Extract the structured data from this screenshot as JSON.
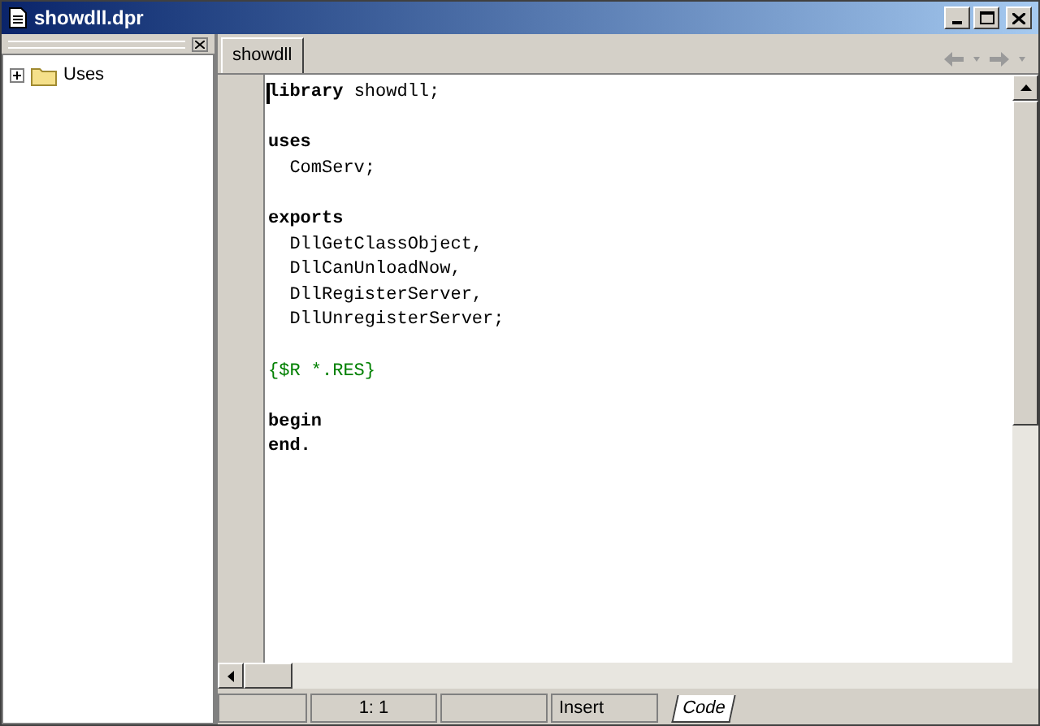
{
  "window": {
    "title": "showdll.dpr"
  },
  "tree": [
    {
      "label": "Uses",
      "expanded": false
    }
  ],
  "tabs": [
    {
      "label": "showdll",
      "selected": true
    }
  ],
  "code": [
    {
      "tokens": [
        {
          "kind": "keyword",
          "text": "library"
        },
        {
          "kind": "plain",
          "text": " showdll;"
        }
      ]
    },
    {
      "blank_line_before": true,
      "tokens": [
        {
          "kind": "keyword",
          "text": "uses"
        }
      ]
    },
    {
      "tokens": [
        {
          "kind": "plain",
          "text": "  ComServ;"
        }
      ]
    },
    {
      "blank_line_before": true,
      "tokens": [
        {
          "kind": "keyword",
          "text": "exports"
        }
      ]
    },
    {
      "tokens": [
        {
          "kind": "plain",
          "text": "  DllGetClassObject,"
        }
      ]
    },
    {
      "tokens": [
        {
          "kind": "plain",
          "text": "  DllCanUnloadNow,"
        }
      ]
    },
    {
      "tokens": [
        {
          "kind": "plain",
          "text": "  DllRegisterServer,"
        }
      ]
    },
    {
      "tokens": [
        {
          "kind": "plain",
          "text": "  DllUnregisterServer;"
        }
      ]
    },
    {
      "blank_line_before": true,
      "tokens": [
        {
          "kind": "comment",
          "text": "{$R *.RES}"
        }
      ]
    },
    {
      "blank_line_before": true,
      "tokens": [
        {
          "kind": "keyword",
          "text": "begin"
        }
      ]
    },
    {
      "tokens": [
        {
          "kind": "keyword",
          "text": "end."
        }
      ]
    }
  ],
  "status_bar": {
    "position": "1:  1",
    "mode": "Insert",
    "view_tab": "Code"
  }
}
